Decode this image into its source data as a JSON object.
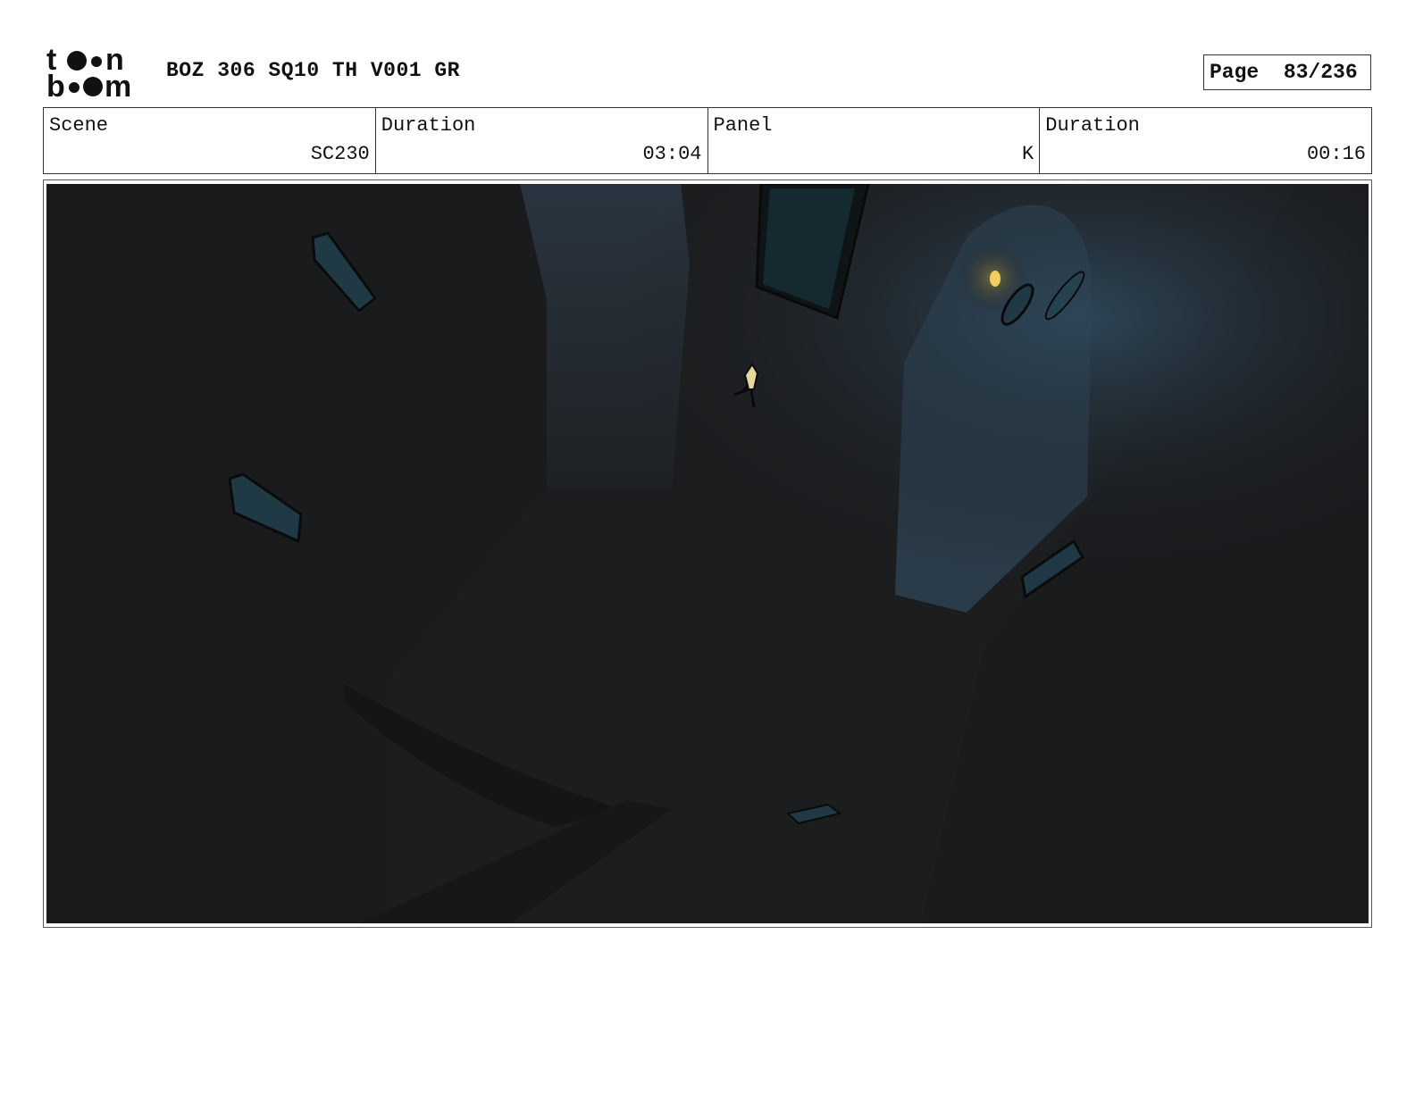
{
  "header": {
    "logo_text_top": "toon",
    "logo_text_bottom": "boom",
    "title": "BOZ 306 SQ10 TH V001 GR",
    "page_label": "Page",
    "page_number": "83/236"
  },
  "info": {
    "scene_label": "Scene",
    "scene_value": "SC230",
    "scene_duration_label": "Duration",
    "scene_duration_value": "03:04",
    "panel_label": "Panel",
    "panel_value": "K",
    "panel_duration_label": "Duration",
    "panel_duration_value": "00:16"
  },
  "colors": {
    "background": "#1c1d1f",
    "window_teal": "#1f3a44",
    "lamp_yellow": "#f2d060",
    "corridor_blue": "#2a3d4c"
  }
}
